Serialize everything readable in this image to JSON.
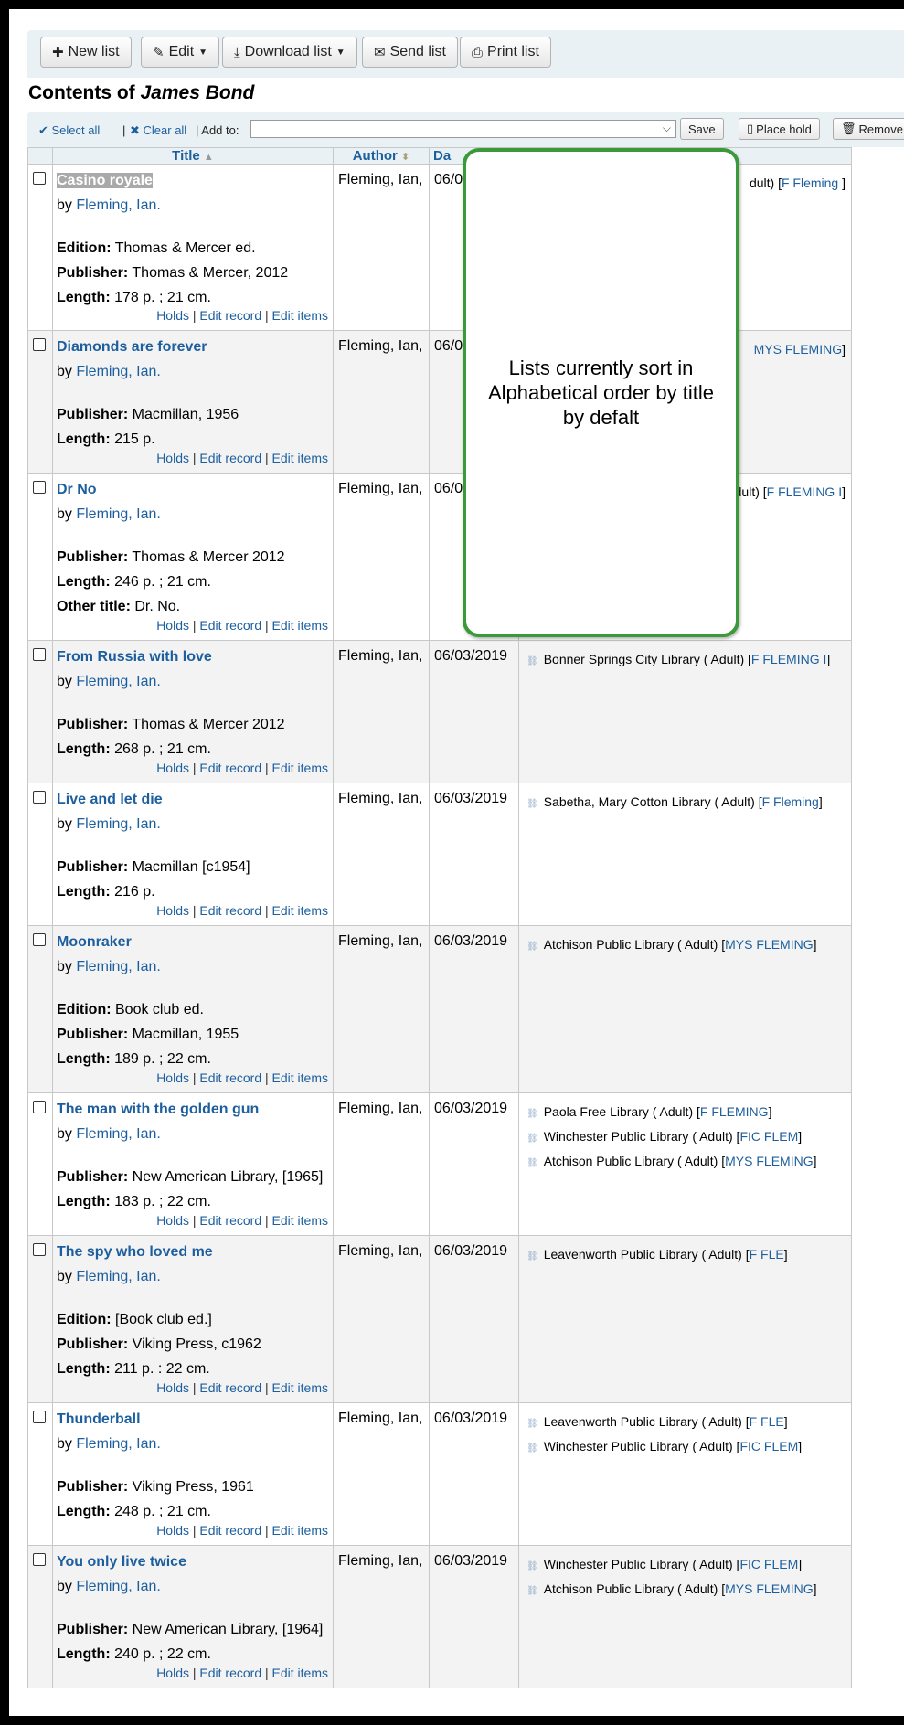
{
  "toolbar": {
    "new_list": "New list",
    "edit": "Edit",
    "download_list": "Download list",
    "send_list": "Send list",
    "print_list": "Print list"
  },
  "heading": {
    "prefix": "Contents of ",
    "list_name": "James Bond"
  },
  "selection_bar": {
    "select_all": "Select all",
    "separator": "|",
    "clear_all": "Clear all",
    "add_to_label": "| Add to:",
    "add_to_value": "",
    "save": "Save",
    "place_hold": "Place hold",
    "remove_selected": "Remove sel"
  },
  "columns": {
    "title": "Title",
    "author": "Author",
    "date": "Da"
  },
  "action_labels": {
    "holds": "Holds",
    "edit_record": "Edit record",
    "edit_items": "Edit items",
    "sep": "|"
  },
  "rows": [
    {
      "title": "Casino royale",
      "by_prefix": "by ",
      "author_link": "Fleming, Ian.",
      "fields": [
        {
          "label": "Edition:",
          "value": " Thomas & Mercer ed."
        },
        {
          "label": "Publisher:",
          "value": " Thomas & Mercer, 2012"
        },
        {
          "label": "Length:",
          "value": " 178 p. ; 21 cm."
        }
      ],
      "author": "Fleming, Ian,",
      "date": "06/03/2019",
      "holdings": [
        {
          "library": "dult) [",
          "call": "F Fleming ",
          "end": "]"
        }
      ]
    },
    {
      "title": "Diamonds are forever",
      "by_prefix": "by ",
      "author_link": "Fleming, Ian.",
      "fields": [
        {
          "label": "Publisher:",
          "value": " Macmillan, 1956"
        },
        {
          "label": "Length:",
          "value": " 215 p."
        }
      ],
      "author": "Fleming, Ian,",
      "date": "06/03/2019",
      "holdings": [
        {
          "library": "",
          "call": "MYS FLEMING",
          "end": "]"
        }
      ]
    },
    {
      "title": "Dr No",
      "by_prefix": "by ",
      "author_link": "Fleming, Ian.",
      "fields": [
        {
          "label": "Publisher:",
          "value": " Thomas & Mercer 2012"
        },
        {
          "label": "Length:",
          "value": " 246 p. ; 21 cm."
        },
        {
          "label": "Other title:",
          "value": " Dr. No."
        }
      ],
      "author": "Fleming, Ian,",
      "date": "06/03/2019",
      "holdings": [
        {
          "library": "dult) [",
          "call": "F FLEMING I",
          "end": "]"
        }
      ]
    },
    {
      "title": "From Russia with love",
      "by_prefix": "by ",
      "author_link": "Fleming, Ian.",
      "fields": [
        {
          "label": "Publisher:",
          "value": " Thomas & Mercer 2012"
        },
        {
          "label": "Length:",
          "value": " 268 p. ; 21 cm."
        }
      ],
      "author": "Fleming, Ian,",
      "date": "06/03/2019",
      "holdings": [
        {
          "library": "Bonner Springs City Library ( Adult) [",
          "call": "F FLEMING I",
          "end": "]"
        }
      ]
    },
    {
      "title": "Live and let die",
      "by_prefix": "by ",
      "author_link": "Fleming, Ian.",
      "fields": [
        {
          "label": "Publisher:",
          "value": " Macmillan [c1954]"
        },
        {
          "label": "Length:",
          "value": " 216 p."
        }
      ],
      "author": "Fleming, Ian,",
      "date": "06/03/2019",
      "holdings": [
        {
          "library": "Sabetha, Mary Cotton Library ( Adult) [",
          "call": "F Fleming",
          "end": "]"
        }
      ]
    },
    {
      "title": "Moonraker",
      "by_prefix": "by ",
      "author_link": "Fleming, Ian.",
      "fields": [
        {
          "label": "Edition:",
          "value": " Book club ed."
        },
        {
          "label": "Publisher:",
          "value": " Macmillan, 1955"
        },
        {
          "label": "Length:",
          "value": " 189 p. ; 22 cm."
        }
      ],
      "author": "Fleming, Ian,",
      "date": "06/03/2019",
      "holdings": [
        {
          "library": "Atchison Public Library ( Adult) [",
          "call": "MYS FLEMING",
          "end": "]"
        }
      ]
    },
    {
      "title": "The man with the golden gun",
      "by_prefix": "by ",
      "author_link": "Fleming, Ian.",
      "fields": [
        {
          "label": "Publisher:",
          "value": " New American Library, [1965]"
        },
        {
          "label": "Length:",
          "value": " 183 p. ; 22 cm."
        }
      ],
      "author": "Fleming, Ian,",
      "date": "06/03/2019",
      "holdings": [
        {
          "library": "Paola Free Library ( Adult) [",
          "call": "F FLEMING",
          "end": "]"
        },
        {
          "library": "Winchester Public Library ( Adult) [",
          "call": "FIC FLEM",
          "end": "]"
        },
        {
          "library": "Atchison Public Library ( Adult) [",
          "call": "MYS FLEMING",
          "end": "]"
        }
      ]
    },
    {
      "title": "The spy who loved me",
      "by_prefix": "by ",
      "author_link": "Fleming, Ian.",
      "fields": [
        {
          "label": "Edition:",
          "value": " [Book club ed.]"
        },
        {
          "label": "Publisher:",
          "value": " Viking Press, c1962"
        },
        {
          "label": "Length:",
          "value": " 211 p. : 22 cm."
        }
      ],
      "author": "Fleming, Ian,",
      "date": "06/03/2019",
      "holdings": [
        {
          "library": "Leavenworth Public Library ( Adult) [",
          "call": "F FLE",
          "end": "]"
        }
      ]
    },
    {
      "title": "Thunderball",
      "by_prefix": "by ",
      "author_link": "Fleming, Ian.",
      "fields": [
        {
          "label": "Publisher:",
          "value": " Viking Press, 1961"
        },
        {
          "label": "Length:",
          "value": " 248 p. ; 21 cm."
        }
      ],
      "author": "Fleming, Ian,",
      "date": "06/03/2019",
      "holdings": [
        {
          "library": "Leavenworth Public Library ( Adult) [",
          "call": "F FLE",
          "end": "]"
        },
        {
          "library": "Winchester Public Library ( Adult) [",
          "call": "FIC FLEM",
          "end": "]"
        }
      ]
    },
    {
      "title": "You only live twice",
      "by_prefix": "by ",
      "author_link": "Fleming, Ian.",
      "fields": [
        {
          "label": "Publisher:",
          "value": " New American Library, [1964]"
        },
        {
          "label": "Length:",
          "value": " 240 p. ; 22 cm."
        }
      ],
      "author": "Fleming, Ian,",
      "date": "06/03/2019",
      "holdings": [
        {
          "library": "Winchester Public Library ( Adult) [",
          "call": "FIC FLEM",
          "end": "]"
        },
        {
          "library": "Atchison Public Library ( Adult) [",
          "call": "MYS FLEMING",
          "end": "]"
        }
      ]
    }
  ],
  "callout": {
    "text": "Lists currently sort in Alphabetical order by title by defalt"
  },
  "colors": {
    "link": "#1d5f9e",
    "toolbar_bg": "#e9f1f5",
    "callout_border": "#3a9a3a",
    "row_alt": "#f3f3f3"
  },
  "icons": {
    "new_list": "plus-icon",
    "edit": "pencil-icon",
    "download": "download-icon",
    "send": "envelope-icon",
    "print": "printer-icon",
    "select_all": "check-icon",
    "clear_all": "x-icon",
    "place_hold": "bookmark-icon",
    "remove": "trash-icon",
    "sort": "sort-arrow-icon",
    "holding": "link-icon"
  }
}
